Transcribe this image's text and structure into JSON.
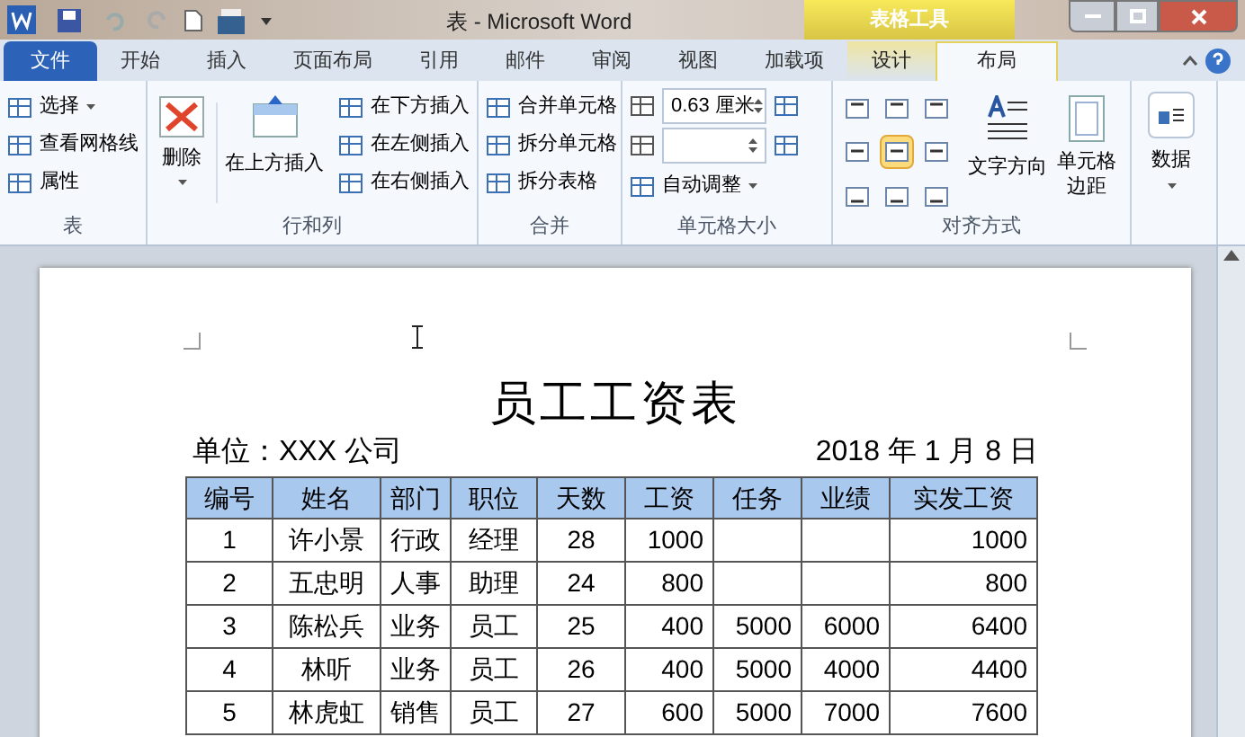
{
  "window": {
    "title": "表 - Microsoft Word",
    "context_tab_group": "表格工具"
  },
  "tabs": [
    {
      "label": "文件",
      "kind": "file",
      "selected": false
    },
    {
      "label": "开始",
      "kind": "normal",
      "selected": false
    },
    {
      "label": "插入",
      "kind": "normal",
      "selected": false
    },
    {
      "label": "页面布局",
      "kind": "normal",
      "selected": false
    },
    {
      "label": "引用",
      "kind": "normal",
      "selected": false
    },
    {
      "label": "邮件",
      "kind": "normal",
      "selected": false
    },
    {
      "label": "审阅",
      "kind": "normal",
      "selected": false
    },
    {
      "label": "视图",
      "kind": "normal",
      "selected": false
    },
    {
      "label": "加载项",
      "kind": "normal",
      "selected": false
    },
    {
      "label": "设计",
      "kind": "context",
      "selected": false
    },
    {
      "label": "布局",
      "kind": "context",
      "selected": true
    }
  ],
  "ribbon": {
    "table_group": {
      "label": "表",
      "items": [
        "选择",
        "查看网格线",
        "属性"
      ]
    },
    "rows_cols_group": {
      "label": "行和列",
      "delete": "删除",
      "insert_above": "在上方插入",
      "items": [
        "在下方插入",
        "在左侧插入",
        "在右侧插入"
      ]
    },
    "merge_group": {
      "label": "合并",
      "items": [
        "合并单元格",
        "拆分单元格",
        "拆分表格"
      ]
    },
    "cell_size_group": {
      "label": "单元格大小",
      "height_value": "0.63 厘米",
      "autofit": "自动调整"
    },
    "alignment_group": {
      "label": "对齐方式",
      "alignments": [
        {
          "selected": false
        },
        {
          "selected": false
        },
        {
          "selected": false
        },
        {
          "selected": false
        },
        {
          "selected": true
        },
        {
          "selected": false
        },
        {
          "selected": false
        },
        {
          "selected": false
        },
        {
          "selected": false
        }
      ],
      "text_direction": "文字方向",
      "cell_margins": "单元格边距"
    },
    "data_group": {
      "label": "数据"
    }
  },
  "document": {
    "title": "员工工资表",
    "unit": "单位：XXX 公司",
    "date": "2018 年 1 月 8 日",
    "table": {
      "columns": [
        "编号",
        "姓名",
        "部门",
        "职位",
        "天数",
        "工资",
        "任务",
        "业绩",
        "实发工资"
      ],
      "rows": [
        [
          "1",
          "许小景",
          "行政",
          "经理",
          "28",
          "1000",
          "",
          "",
          "1000"
        ],
        [
          "2",
          "五忠明",
          "人事",
          "助理",
          "24",
          "800",
          "",
          "",
          "800"
        ],
        [
          "3",
          "陈松兵",
          "业务",
          "员工",
          "25",
          "400",
          "5000",
          "6000",
          "6400"
        ],
        [
          "4",
          "林听",
          "业务",
          "员工",
          "26",
          "400",
          "5000",
          "4000",
          "4400"
        ],
        [
          "5",
          "林虎虹",
          "销售",
          "员工",
          "27",
          "600",
          "5000",
          "7000",
          "7600"
        ]
      ]
    }
  }
}
